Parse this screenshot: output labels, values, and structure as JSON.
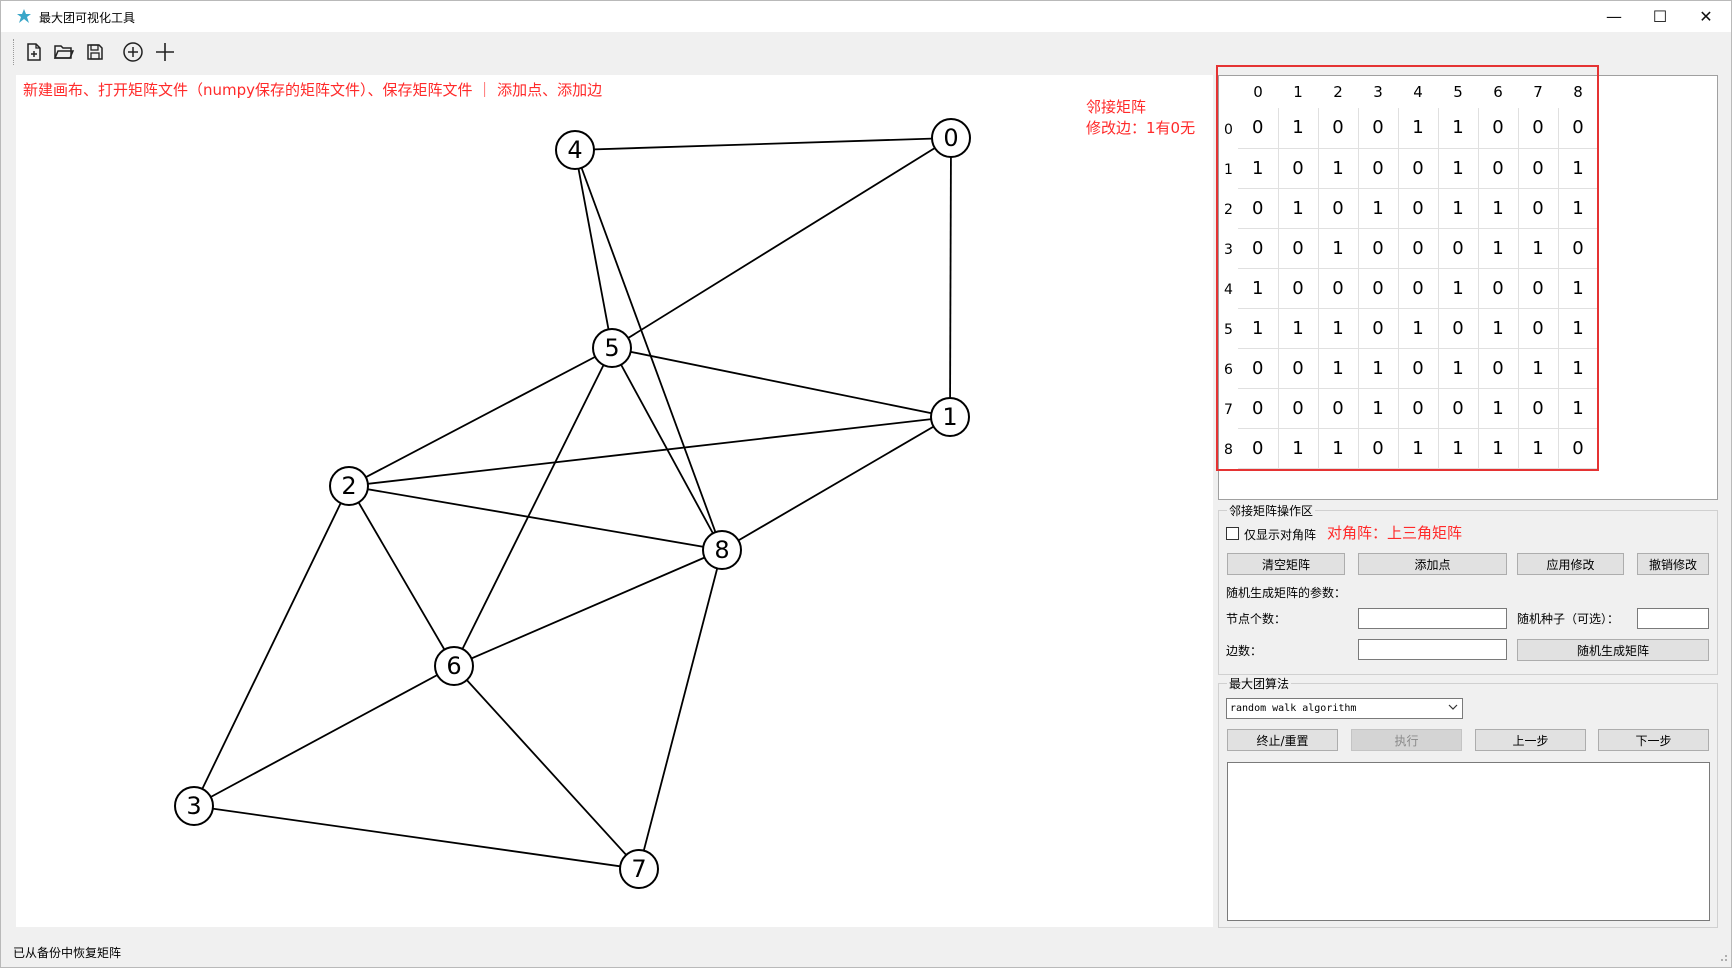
{
  "window": {
    "title": "最大团可视化工具",
    "minimize_glyph": "—",
    "maximize_glyph": "☐",
    "close_glyph": "✕"
  },
  "toolbar": {
    "icons": [
      "new-file-icon",
      "open-folder-icon",
      "save-icon",
      "add-node-icon",
      "add-edge-icon"
    ]
  },
  "canvas": {
    "hint": "新建画布、打开矩阵文件（numpy保存的矩阵文件）、保存矩阵文件 ｜ 添加点、添加边",
    "adj_title_line1": "邻接矩阵",
    "adj_title_line2": "修改边：1有0无"
  },
  "graph": {
    "nodes": [
      "0",
      "1",
      "2",
      "3",
      "4",
      "5",
      "6",
      "7",
      "8"
    ],
    "edges": [
      [
        0,
        1
      ],
      [
        0,
        4
      ],
      [
        0,
        5
      ],
      [
        1,
        2
      ],
      [
        1,
        5
      ],
      [
        1,
        8
      ],
      [
        2,
        3
      ],
      [
        2,
        5
      ],
      [
        2,
        6
      ],
      [
        2,
        8
      ],
      [
        3,
        6
      ],
      [
        3,
        7
      ],
      [
        4,
        5
      ],
      [
        4,
        8
      ],
      [
        5,
        6
      ],
      [
        5,
        8
      ],
      [
        6,
        7
      ],
      [
        6,
        8
      ],
      [
        7,
        8
      ]
    ]
  },
  "matrix": {
    "headers": [
      "0",
      "1",
      "2",
      "3",
      "4",
      "5",
      "6",
      "7",
      "8"
    ],
    "rows": [
      [
        "0",
        "1",
        "0",
        "0",
        "1",
        "1",
        "0",
        "0",
        "0"
      ],
      [
        "1",
        "0",
        "1",
        "0",
        "0",
        "1",
        "0",
        "0",
        "1"
      ],
      [
        "0",
        "1",
        "0",
        "1",
        "0",
        "1",
        "1",
        "0",
        "1"
      ],
      [
        "0",
        "0",
        "1",
        "0",
        "0",
        "0",
        "1",
        "1",
        "0"
      ],
      [
        "1",
        "0",
        "0",
        "0",
        "0",
        "1",
        "0",
        "0",
        "1"
      ],
      [
        "1",
        "1",
        "1",
        "0",
        "1",
        "0",
        "1",
        "0",
        "1"
      ],
      [
        "0",
        "0",
        "1",
        "1",
        "0",
        "1",
        "0",
        "1",
        "1"
      ],
      [
        "0",
        "0",
        "0",
        "1",
        "0",
        "0",
        "1",
        "0",
        "1"
      ],
      [
        "0",
        "1",
        "1",
        "0",
        "1",
        "1",
        "1",
        "1",
        "0"
      ]
    ]
  },
  "ops": {
    "group_title": "邻接矩阵操作区",
    "only_diag_label": "仅显示对角阵",
    "diag_note": "对角阵：上三角矩阵",
    "clear_btn": "清空矩阵",
    "add_node_btn": "添加点",
    "apply_btn": "应用修改",
    "undo_btn": "撤销修改",
    "random_params_label": "随机生成矩阵的参数：",
    "node_count_label": "节点个数：",
    "seed_label": "随机种子（可选）：",
    "edge_count_label": "边数：",
    "random_gen_btn": "随机生成矩阵"
  },
  "algo": {
    "group_title": "最大团算法",
    "selected": "random walk algorithm",
    "stop_btn": "终止/重置",
    "run_btn": "执行",
    "prev_btn": "上一步",
    "next_btn": "下一步"
  },
  "status": {
    "text": "已从备份中恢复矩阵"
  }
}
